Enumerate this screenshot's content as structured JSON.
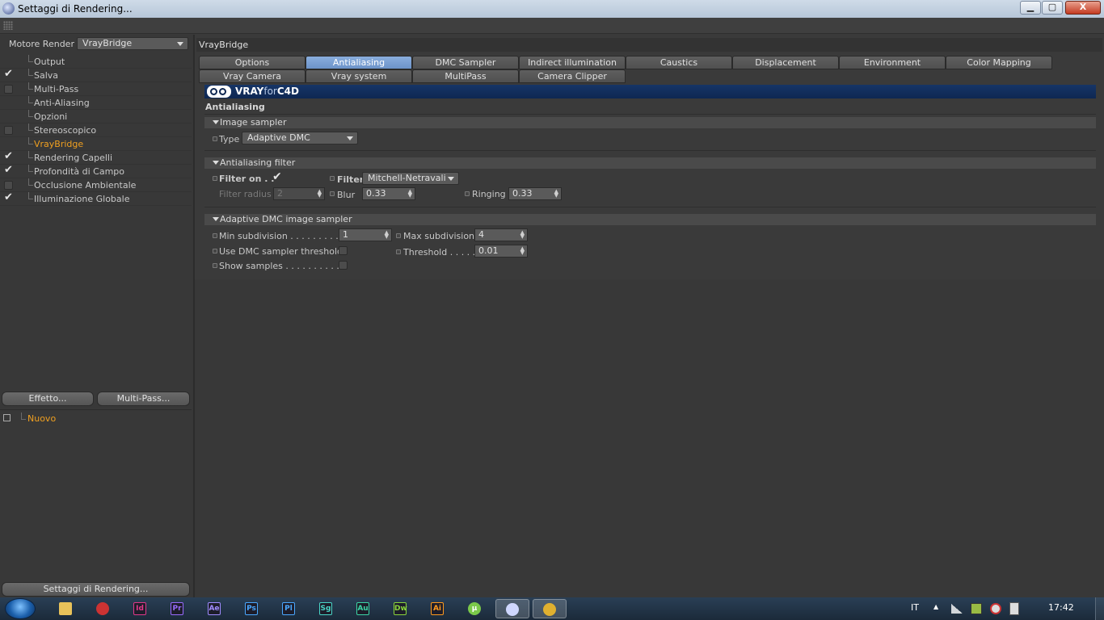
{
  "window": {
    "title": "Settaggi di Rendering...",
    "subtitle": "",
    "buttons": {
      "minimize": "▁",
      "maximize": "▢",
      "close": "X"
    }
  },
  "left": {
    "engine_label": "Motore Render",
    "engine_value": "VrayBridge",
    "items": [
      {
        "label": "Output",
        "check": "none"
      },
      {
        "label": "Salva",
        "check": "checked"
      },
      {
        "label": "Multi-Pass",
        "check": "box"
      },
      {
        "label": "Anti-Aliasing",
        "check": "none"
      },
      {
        "label": "Opzioni",
        "check": "none"
      },
      {
        "label": "Stereoscopico",
        "check": "box"
      },
      {
        "label": "VrayBridge",
        "check": "none",
        "selected": true
      },
      {
        "label": "Rendering Capelli",
        "check": "checked"
      },
      {
        "label": "Profondità di Campo",
        "check": "checked"
      },
      {
        "label": "Occlusione Ambientale",
        "check": "box"
      },
      {
        "label": "Illuminazione Globale",
        "check": "checked"
      }
    ],
    "effect_button": "Effetto...",
    "multipass_button": "Multi-Pass...",
    "preset_item": "Nuovo",
    "bottom_button": "Settaggi di Rendering..."
  },
  "right": {
    "header": "VrayBridge",
    "tabs_row1": [
      "Options",
      "Antialiasing",
      "DMC Sampler",
      "Indirect illumination (GI)",
      "Caustics",
      "Displacement",
      "Environment",
      "Color Mapping"
    ],
    "tabs_row2": [
      "Vray Camera",
      "Vray system",
      "MultiPass",
      "Camera Clipper"
    ],
    "active_tab": "Antialiasing",
    "banner": {
      "logo_part1": "VRAY",
      "logo_part2": "for",
      "logo_part3": "C4D"
    },
    "section_title": "Antialiasing",
    "image_sampler": {
      "title": "Image sampler",
      "type_label": "Type",
      "type_value": "Adaptive DMC"
    },
    "aa_filter": {
      "title": "Antialiasing filter",
      "filter_on_label": "Filter on  . .",
      "filter_on": true,
      "filter_label": "Filter",
      "filter_value": "Mitchell-Netravali",
      "radius_label": "Filter radius",
      "radius_value": "2",
      "blur_label": "Blur",
      "blur_value": "0.33",
      "ringing_label": "Ringing",
      "ringing_value": "0.33"
    },
    "adaptive": {
      "title": "Adaptive DMC image sampler",
      "min_label": "Min subdivision . . . . . . . . . .",
      "min_value": "1",
      "max_label": "Max subdivision",
      "max_value": "4",
      "use_threshold_label": "Use DMC sampler threshold",
      "threshold_label": "Threshold . . . . .",
      "threshold_value": "0.01",
      "show_samples_label": "Show samples  . . . . . . . . . . ."
    }
  },
  "taskbar": {
    "apps": [
      {
        "name": "explorer",
        "text": "",
        "color": "#e8c25a"
      },
      {
        "name": "media",
        "text": "",
        "color": "#c33"
      },
      {
        "name": "indesign",
        "text": "Id",
        "color": "#e0388a"
      },
      {
        "name": "premiere",
        "text": "Pr",
        "color": "#9a6bff"
      },
      {
        "name": "aftereffects",
        "text": "Ae",
        "color": "#a08cff"
      },
      {
        "name": "photoshop",
        "text": "Ps",
        "color": "#4aa8ff"
      },
      {
        "name": "prelude",
        "text": "Pl",
        "color": "#4aa8ff"
      },
      {
        "name": "speedgrade",
        "text": "Sg",
        "color": "#4ad6c8"
      },
      {
        "name": "audition",
        "text": "Au",
        "color": "#3cd6a6"
      },
      {
        "name": "dreamweaver",
        "text": "Dw",
        "color": "#8ad63c"
      },
      {
        "name": "illustrator",
        "text": "Ai",
        "color": "#ff9a1e"
      },
      {
        "name": "utorrent",
        "text": "µ",
        "color": "#7bc94a"
      },
      {
        "name": "cinema4d",
        "text": "",
        "color": "#cfd7ff"
      },
      {
        "name": "chrome",
        "text": "",
        "color": "#e0b030"
      }
    ],
    "language": "IT",
    "clock": "17:42"
  }
}
